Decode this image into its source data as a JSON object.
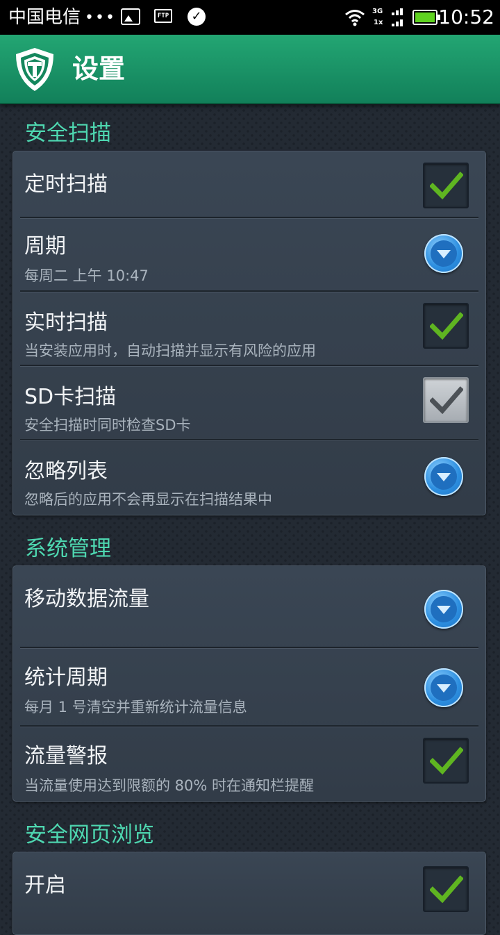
{
  "status_bar": {
    "carrier": "中国电信",
    "dots": "•••",
    "ftp_label": "FTP",
    "net_top": "3G",
    "net_bottom": "1x",
    "time": "10:52",
    "icons": [
      "image-icon",
      "ftp-icon",
      "check-circle-icon",
      "wifi-icon",
      "signal-icon",
      "battery-icon"
    ]
  },
  "app_bar": {
    "title": "设置",
    "icon": "shield-icon"
  },
  "colors": {
    "accent_green": "#4ed7b0",
    "header_green": "#1a9468",
    "check_green": "#5fb521",
    "dropdown_blue": "#2d8fe0"
  },
  "sections": [
    {
      "title": "安全扫描",
      "items": [
        {
          "title": "定时扫描",
          "subtitle": "",
          "control": "checkbox",
          "checked": true,
          "enabled": true
        },
        {
          "title": "周期",
          "subtitle": "每周二 上午 10:47",
          "control": "dropdown"
        },
        {
          "title": "实时扫描",
          "subtitle": "当安装应用时，自动扫描并显示有风险的应用",
          "control": "checkbox",
          "checked": true,
          "enabled": true
        },
        {
          "title": "SD卡扫描",
          "subtitle": "安全扫描时同时检查SD卡",
          "control": "checkbox",
          "checked": true,
          "enabled": false
        },
        {
          "title": "忽略列表",
          "subtitle": "忽略后的应用不会再显示在扫描结果中",
          "control": "dropdown"
        }
      ]
    },
    {
      "title": "系统管理",
      "items": [
        {
          "title": "移动数据流量",
          "subtitle": "",
          "control": "dropdown"
        },
        {
          "title": "统计周期",
          "subtitle": "每月 1 号清空并重新统计流量信息",
          "control": "dropdown"
        },
        {
          "title": "流量警报",
          "subtitle": "当流量使用达到限额的 80% 时在通知栏提醒",
          "control": "checkbox",
          "checked": true,
          "enabled": true
        }
      ]
    },
    {
      "title": "安全网页浏览",
      "items": [
        {
          "title": "开启",
          "subtitle": "",
          "control": "checkbox",
          "checked": true,
          "enabled": true
        }
      ]
    }
  ]
}
